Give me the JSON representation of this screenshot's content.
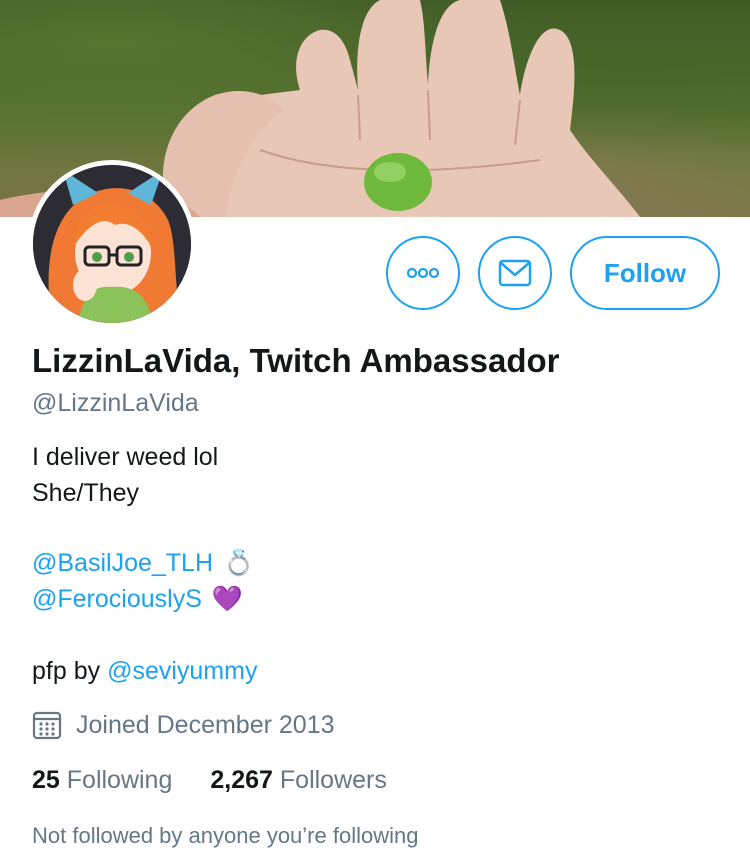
{
  "profile": {
    "display_name": "LizzinLaVida, Twitch Ambassador",
    "handle": "@LizzinLaVida",
    "bio_line1": "I deliver weed lol",
    "bio_line2": "She/They",
    "mentions": [
      {
        "text": "@BasilJoe_TLH",
        "emoji": "💍",
        "emoji_name": "ring-emoji"
      },
      {
        "text": "@FerociouslyS",
        "emoji": "💜",
        "emoji_name": "purple-heart-emoji"
      }
    ],
    "pfp_prefix": "pfp by ",
    "pfp_link": "@seviyummy",
    "joined": "Joined December 2013",
    "following_count": "25",
    "following_label": "Following",
    "followers_count": "2,267",
    "followers_label": "Followers",
    "not_followed_text": "Not followed by anyone you’re following"
  },
  "actions": {
    "more_icon": "more-horizontal-icon",
    "dm_icon": "envelope-icon",
    "follow_label": "Follow"
  },
  "colors": {
    "accent": "#1da1f2",
    "text_primary": "#14171a",
    "text_secondary": "#657786"
  }
}
